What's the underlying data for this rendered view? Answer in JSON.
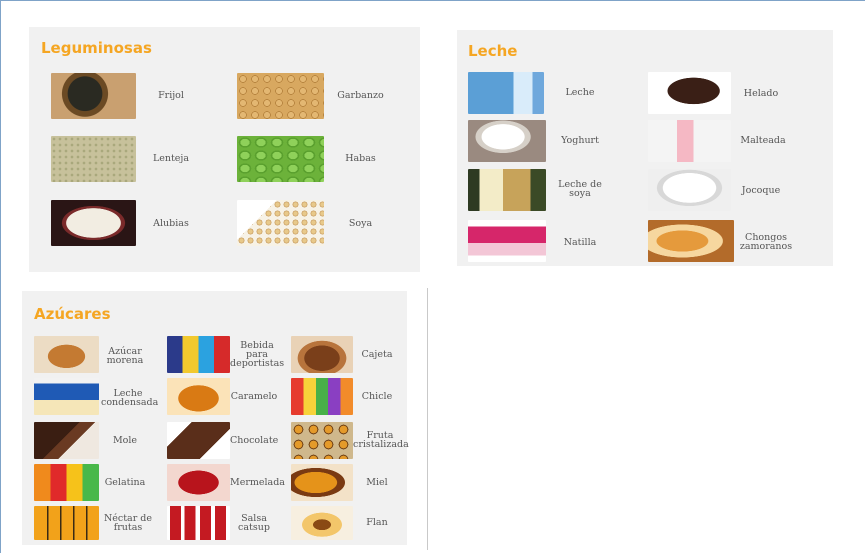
{
  "leguminosas": {
    "title": "Leguminosas",
    "items": [
      {
        "label": "Frijol",
        "image": "black beans in wooden bowl"
      },
      {
        "label": "Garbanzo",
        "image": "chickpeas"
      },
      {
        "label": "Lenteja",
        "image": "lentils"
      },
      {
        "label": "Habas",
        "image": "green fava beans"
      },
      {
        "label": "Alubias",
        "image": "white beans in dark bowl"
      },
      {
        "label": "Soya",
        "image": "soybeans on spoon"
      }
    ]
  },
  "leche": {
    "title": "Leche",
    "items": [
      {
        "label": "Leche",
        "image": "milk pouring into glass"
      },
      {
        "label": "Helado",
        "image": "chocolate ice cream"
      },
      {
        "label": "Yoghurt",
        "image": "bowl of yoghurt"
      },
      {
        "label": "Malteada",
        "image": "pink milkshake"
      },
      {
        "label": "Leche de\nsoya",
        "image": "glass of soy milk"
      },
      {
        "label": "Jocoque",
        "image": "white cream in bowl"
      },
      {
        "label": "Natilla",
        "image": "custard cup package"
      },
      {
        "label": "Chongos\nzamoranos",
        "image": "chongos dessert"
      }
    ]
  },
  "azucares": {
    "title": "Azúcares",
    "items": [
      {
        "label": "Azúcar\nmorena",
        "image": "brown sugar"
      },
      {
        "label": "Bebida\npara\ndeportistas",
        "image": "sports drink bottles"
      },
      {
        "label": "Cajeta",
        "image": "cajeta swirl"
      },
      {
        "label": "Leche\ncondensada",
        "image": "condensed milk can"
      },
      {
        "label": "Caramelo",
        "image": "caramel sauce"
      },
      {
        "label": "Chicle",
        "image": "colorful gum"
      },
      {
        "label": "Mole",
        "image": "mole paste"
      },
      {
        "label": "Chocolate",
        "image": "chocolate pieces"
      },
      {
        "label": "Fruta\ncristalizada",
        "image": "candied fruit"
      },
      {
        "label": "Gelatina",
        "image": "jello cups"
      },
      {
        "label": "Mermelada",
        "image": "red jam"
      },
      {
        "label": "Miel",
        "image": "honey and honeycomb"
      },
      {
        "label": "Néctar de\nfrutas",
        "image": "fruit nectar bottles"
      },
      {
        "label": "Salsa\ncatsup",
        "image": "ketchup bottles"
      },
      {
        "label": "Flan",
        "image": "flan dessert"
      }
    ]
  }
}
